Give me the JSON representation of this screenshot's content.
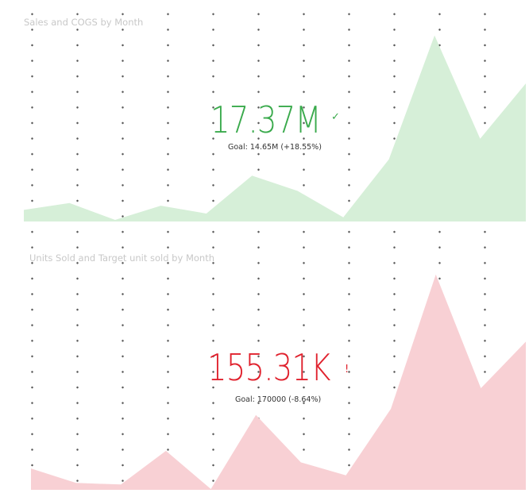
{
  "kpi_sales": {
    "title": "Sales and COGS by Month",
    "value": "17.37M",
    "indicator": "✓",
    "goal_label": "Goal:",
    "goal_value": "14.65M",
    "goal_delta": "(+18.55%)",
    "status_color": "#3aaa4c",
    "area_color": "#d6efd8",
    "trend": [
      2.2,
      3.5,
      0.3,
      3.0,
      1.5,
      8.7,
      5.8,
      0.8,
      11.8,
      35.3,
      15.7,
      26.2
    ]
  },
  "kpi_units": {
    "title": "Units Sold and Target unit sold by Month",
    "value": "155.31K",
    "indicator": "!",
    "goal_label": "Goal:",
    "goal_value": "170000",
    "goal_delta": "(-8.64%)",
    "status_color": "#e0212d",
    "area_color": "#f8d0d4",
    "trend": [
      2.8,
      0.9,
      0.7,
      5.1,
      0.1,
      9.8,
      3.6,
      1.9,
      10.6,
      28.2,
      13.3,
      19.4
    ]
  }
}
